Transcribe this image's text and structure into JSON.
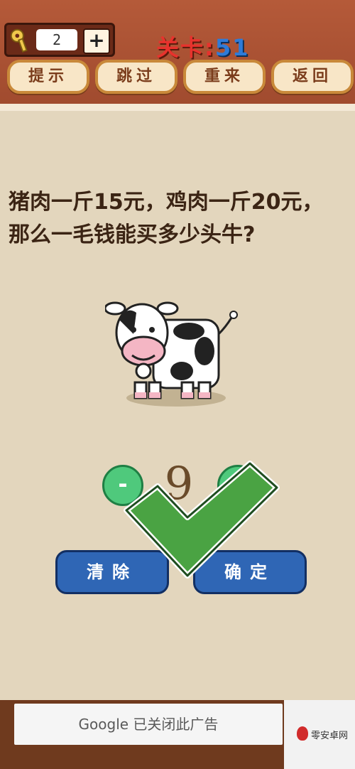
{
  "header": {
    "key_count": "2",
    "add_label": "+",
    "level_label": "关卡:",
    "level_value": "51",
    "buttons": [
      "提示",
      "跳过",
      "重来",
      "返回"
    ]
  },
  "question": {
    "line1": "猪肉一斤15元，鸡肉一斤20元，",
    "line2": "那么一毛钱能买多少头牛?"
  },
  "answer": {
    "minus": "-",
    "value": "9",
    "plus": "+"
  },
  "actions": {
    "clear": "清除",
    "confirm": "确定"
  },
  "ad": {
    "text": "Google 已关闭此广告"
  },
  "watermark": {
    "text": "零安卓网"
  },
  "colors": {
    "header_bg": "#a8522f",
    "level_label": "#e8322d",
    "level_value": "#2f7bd8",
    "check_green": "#4aa343",
    "button_blue": "#2f66b5"
  }
}
